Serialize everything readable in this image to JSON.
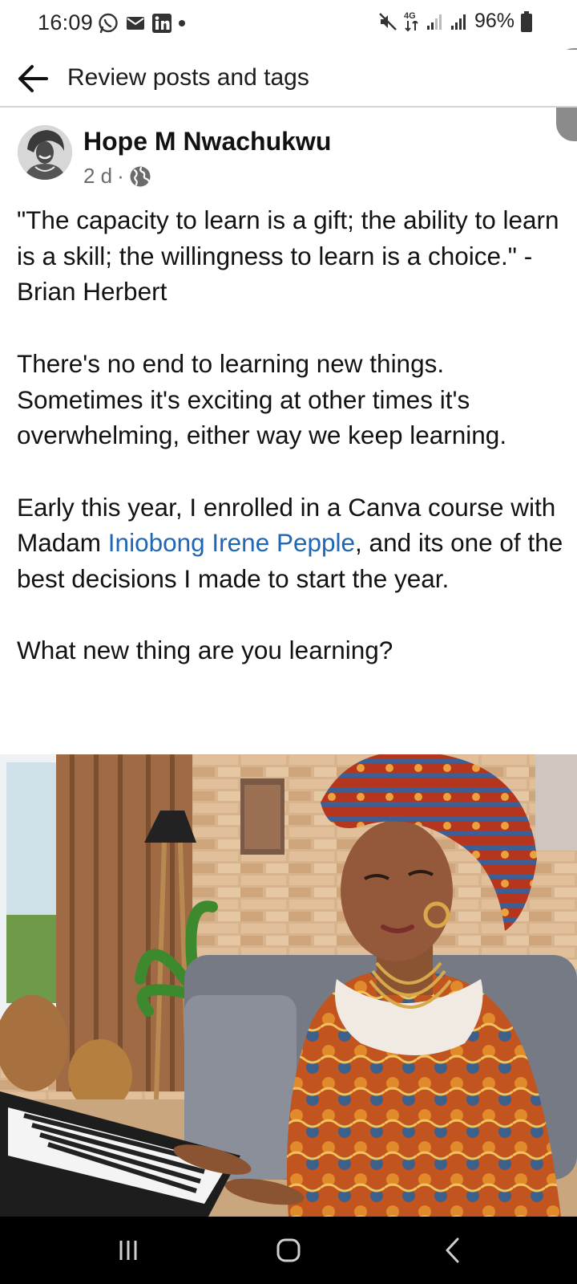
{
  "status_bar": {
    "time": "16:09",
    "left_icons": [
      "whatsapp-icon",
      "mail-icon",
      "linkedin-icon",
      "dot-icon"
    ],
    "right_icons": [
      "mute-icon",
      "4g-icon",
      "signal-icon",
      "signal-icon",
      "battery-icon"
    ],
    "network_label": "4G",
    "battery_percent": "96%"
  },
  "top_bar": {
    "title": "Review posts and tags"
  },
  "post": {
    "author": "Hope M Nwachukwu",
    "time_ago": "2 d",
    "separator": "·",
    "audience_icon": "globe-icon",
    "paragraphs": {
      "p1": "\"The capacity to learn is a gift; the ability to learn is a skill; the willingness to learn is a choice.\" - Brian Herbert",
      "p2": "There's no end to learning new things. Sometimes it's exciting at other times it's overwhelming, either way we keep learning.",
      "p3_before": "Early this year, I enrolled in  a  Canva course with Madam ",
      "p3_mention": "Iniobong Irene Pepple",
      "p3_after": ",  and its one of the best decisions I made to start the year.",
      "p4": "What new thing are you learning?"
    }
  },
  "colors": {
    "mention": "#1f66b5",
    "nav_bar": "#000000",
    "accessibility_tab": "#8b8b8b"
  }
}
